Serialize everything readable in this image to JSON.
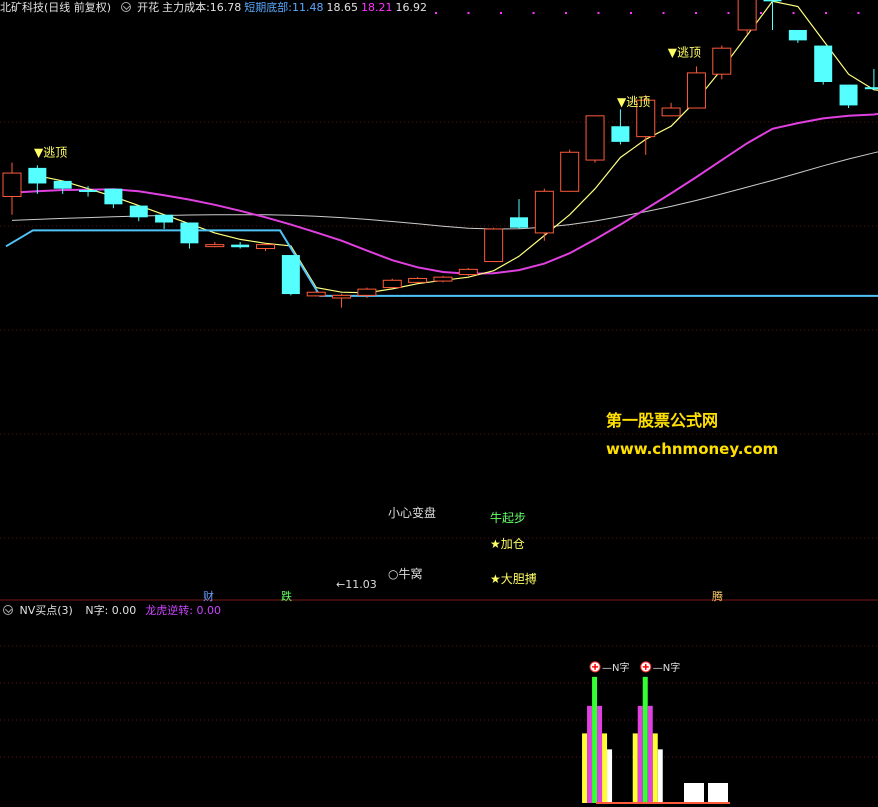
{
  "main_panel": {
    "title": "北矿科技(日线 前复权)",
    "legend": [
      {
        "label": "开花",
        "value": "",
        "color": "#e0e0e0"
      },
      {
        "label": "主力成本:",
        "value": "16.78",
        "color": "#e0e0e0"
      },
      {
        "label": "短期底部:",
        "value": "11.48",
        "color": "#5aaaff"
      },
      {
        "label": "",
        "value": "18.65",
        "color": "#e0e0e0"
      },
      {
        "label": "",
        "value": "18.21",
        "color": "#ff33ff"
      },
      {
        "label": "",
        "value": "16.92",
        "color": "#e0e0e0"
      }
    ],
    "annotations": {
      "escape_top": "▼逃顶",
      "careful_change": "小心变盘",
      "bull_nest": "○牛窝",
      "low_price": "←11.03",
      "bull_start": "牛起步",
      "add_position": "★加仓",
      "bold_bet": "★大胆搏",
      "finance": "财",
      "fall": "跌",
      "rise": "腾"
    },
    "watermark": {
      "line1": "第一股票公式网",
      "line2": "www.chnmoney.com"
    }
  },
  "sub_panel": {
    "title": "NV买点(3)",
    "legend": [
      {
        "label": "N字:",
        "value": "0.00",
        "color": "#e0e0e0"
      },
      {
        "label": "龙虎逆转:",
        "value": "0.00",
        "color": "#cc44ff"
      }
    ],
    "n_label": "N字"
  },
  "chart_data": {
    "type": "candlestick",
    "candles": [
      {
        "o": 15.3,
        "h": 16.6,
        "l": 14.6,
        "c": 16.2,
        "up": true
      },
      {
        "o": 16.4,
        "h": 16.5,
        "l": 15.4,
        "c": 15.8,
        "up": false
      },
      {
        "o": 15.9,
        "h": 15.9,
        "l": 15.4,
        "c": 15.6,
        "up": false
      },
      {
        "o": 15.55,
        "h": 15.7,
        "l": 15.3,
        "c": 15.5,
        "up": false
      },
      {
        "o": 15.6,
        "h": 15.6,
        "l": 14.85,
        "c": 15.0,
        "up": false
      },
      {
        "o": 14.95,
        "h": 14.95,
        "l": 14.35,
        "c": 14.5,
        "up": false
      },
      {
        "o": 14.6,
        "h": 14.6,
        "l": 14.05,
        "c": 14.3,
        "up": false
      },
      {
        "o": 14.3,
        "h": 14.3,
        "l": 13.3,
        "c": 13.5,
        "up": false
      },
      {
        "o": 13.45,
        "h": 13.55,
        "l": 13.35,
        "c": 13.4,
        "up": true
      },
      {
        "o": 13.45,
        "h": 13.55,
        "l": 13.3,
        "c": 13.35,
        "up": false
      },
      {
        "o": 13.3,
        "h": 13.5,
        "l": 13.2,
        "c": 13.45,
        "up": true
      },
      {
        "o": 13.05,
        "h": 13.05,
        "l": 11.5,
        "c": 11.55,
        "up": false
      },
      {
        "o": 11.48,
        "h": 11.66,
        "l": 11.46,
        "c": 11.62,
        "up": true
      },
      {
        "o": 11.4,
        "h": 11.56,
        "l": 11.03,
        "c": 11.5,
        "up": true
      },
      {
        "o": 11.5,
        "h": 11.8,
        "l": 11.4,
        "c": 11.74,
        "up": true
      },
      {
        "o": 11.8,
        "h": 12.14,
        "l": 11.8,
        "c": 12.08,
        "up": true
      },
      {
        "o": 12.0,
        "h": 12.2,
        "l": 11.98,
        "c": 12.15,
        "up": true
      },
      {
        "o": 12.05,
        "h": 12.25,
        "l": 12.0,
        "c": 12.2,
        "up": true
      },
      {
        "o": 12.3,
        "h": 12.55,
        "l": 12.25,
        "c": 12.5,
        "up": true
      },
      {
        "o": 12.8,
        "h": 14.1,
        "l": 12.8,
        "c": 14.05,
        "up": true
      },
      {
        "o": 14.1,
        "h": 15.2,
        "l": 14.05,
        "c": 14.5,
        "up": false
      },
      {
        "o": 13.9,
        "h": 15.6,
        "l": 13.6,
        "c": 15.5,
        "up": true
      },
      {
        "o": 15.5,
        "h": 17.1,
        "l": 15.5,
        "c": 17.0,
        "up": true
      },
      {
        "o": 16.7,
        "h": 18.4,
        "l": 16.6,
        "c": 18.4,
        "up": true
      },
      {
        "o": 18.0,
        "h": 18.65,
        "l": 17.3,
        "c": 17.4,
        "up": false
      },
      {
        "o": 17.6,
        "h": 19.2,
        "l": 16.9,
        "c": 19.0,
        "up": true
      },
      {
        "o": 18.4,
        "h": 18.9,
        "l": 18.4,
        "c": 18.7,
        "up": true
      },
      {
        "o": 18.7,
        "h": 20.3,
        "l": 18.7,
        "c": 20.05,
        "up": true
      },
      {
        "o": 20.0,
        "h": 21.1,
        "l": 19.8,
        "c": 21.0,
        "up": true
      },
      {
        "o": 21.7,
        "h": 23.3,
        "l": 21.55,
        "c": 23.1,
        "up": true
      },
      {
        "o": 24.0,
        "h": 24.2,
        "l": 21.7,
        "c": 22.8,
        "up": false
      },
      {
        "o": 21.7,
        "h": 21.7,
        "l": 21.2,
        "c": 21.3,
        "up": false
      },
      {
        "o": 21.1,
        "h": 21.1,
        "l": 19.6,
        "c": 19.7,
        "up": false
      },
      {
        "o": 19.6,
        "h": 19.6,
        "l": 18.7,
        "c": 18.8,
        "up": false
      },
      {
        "o": 19.5,
        "h": 20.2,
        "l": 19.4,
        "c": 19.45,
        "up": false
      },
      {
        "o": 19.2,
        "h": 20.1,
        "l": 18.9,
        "c": 20.0,
        "up": true
      }
    ],
    "yellow_ma": [
      null,
      16.1,
      15.9,
      15.6,
      15.3,
      14.95,
      14.6,
      14.25,
      13.9,
      13.65,
      13.5,
      13.4,
      11.8,
      11.62,
      11.6,
      11.75,
      11.95,
      12.08,
      12.2,
      12.45,
      13.0,
      13.8,
      14.6,
      15.6,
      16.8,
      17.5,
      18.0,
      19.0,
      20.2,
      21.5,
      22.8,
      22.6,
      21.3,
      20.0,
      19.4,
      19.3
    ],
    "magenta_ma": [
      15.45,
      15.5,
      15.55,
      15.56,
      15.58,
      15.5,
      15.35,
      15.18,
      14.98,
      14.75,
      14.5,
      14.22,
      13.92,
      13.6,
      13.22,
      12.85,
      12.58,
      12.4,
      12.33,
      12.35,
      12.47,
      12.72,
      13.12,
      13.65,
      14.22,
      14.82,
      15.42,
      16.05,
      16.7,
      17.35,
      17.9,
      18.12,
      18.3,
      18.4,
      18.45,
      18.6
    ],
    "white_ma": [
      14.38,
      14.42,
      14.46,
      14.49,
      14.52,
      14.55,
      14.57,
      14.59,
      14.6,
      14.6,
      14.6,
      14.58,
      14.54,
      14.49,
      14.42,
      14.34,
      14.25,
      14.16,
      14.08,
      14.05,
      14.06,
      14.12,
      14.22,
      14.36,
      14.53,
      14.72,
      14.92,
      15.15,
      15.4,
      15.66,
      15.92,
      16.2,
      16.48,
      16.74,
      16.98,
      17.2
    ],
    "support_line": {
      "left": 13.4,
      "mid": 14.0,
      "right": 11.48
    },
    "sub_bars": [
      {
        "index": 23,
        "yellow": 0.48,
        "magenta": 0.67,
        "white": 0.37,
        "green": 0.87
      },
      {
        "index": 25,
        "yellow": 0.48,
        "magenta": 0.67,
        "white": 0.37,
        "green": 0.87
      }
    ]
  }
}
